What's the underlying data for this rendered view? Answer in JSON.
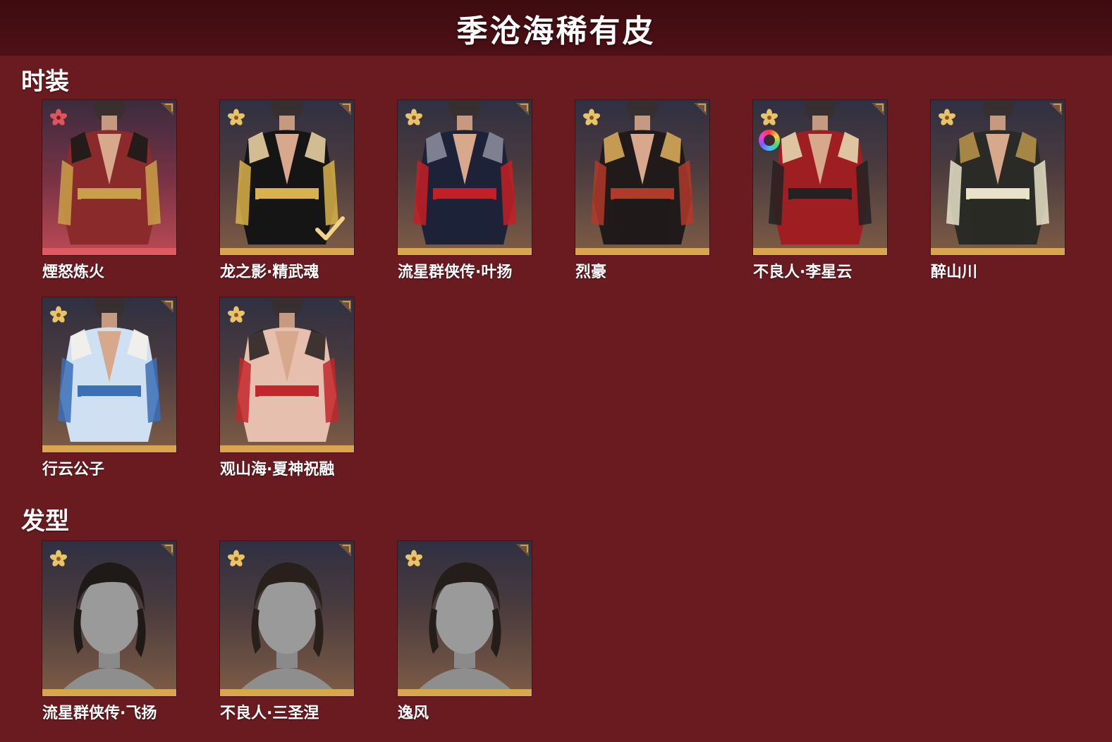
{
  "title": "季沧海稀有皮",
  "sections": [
    {
      "heading": "时装",
      "items": [
        {
          "name": "煙怒炼火",
          "rarity_icon": "red-flower-icon",
          "figure": "outfit",
          "colors": [
            "#8a2a2a",
            "#c9a04a",
            "#1a1a1a"
          ],
          "equipped": false,
          "dye": false
        },
        {
          "name": "龙之影·精武魂",
          "rarity_icon": "gold-flower-icon",
          "figure": "outfit",
          "colors": [
            "#151515",
            "#d8b24a",
            "#e7cfa0"
          ],
          "equipped": true,
          "dye": false
        },
        {
          "name": "流星群侠传·叶扬",
          "rarity_icon": "gold-flower-icon",
          "figure": "outfit",
          "colors": [
            "#1d2238",
            "#c41f25",
            "#8a8a9a"
          ],
          "equipped": false,
          "dye": false
        },
        {
          "name": "烈豪",
          "rarity_icon": "gold-flower-icon",
          "figure": "outfit",
          "colors": [
            "#201a1a",
            "#b23a2a",
            "#d7a85a"
          ],
          "equipped": false,
          "dye": false
        },
        {
          "name": "不良人·李星云",
          "rarity_icon": "gold-flower-icon",
          "figure": "outfit",
          "colors": [
            "#9e1e22",
            "#222222",
            "#e6d6b0"
          ],
          "equipped": false,
          "dye": true
        },
        {
          "name": "醉山川",
          "rarity_icon": "gold-flower-icon",
          "figure": "outfit",
          "colors": [
            "#2a2a26",
            "#e8e2c8",
            "#b39048"
          ],
          "equipped": false,
          "dye": false
        },
        {
          "name": "行云公子",
          "rarity_icon": "gold-flower-icon",
          "figure": "outfit",
          "colors": [
            "#cfe0f2",
            "#3b6fb8",
            "#f4f1ea"
          ],
          "equipped": false,
          "dye": false
        },
        {
          "name": "观山海·夏神祝融",
          "rarity_icon": "gold-flower-icon",
          "figure": "outfit",
          "colors": [
            "#e7bfae",
            "#c2272b",
            "#2a2424"
          ],
          "equipped": false,
          "dye": false
        }
      ]
    },
    {
      "heading": "发型",
      "items": [
        {
          "name": "流星群侠传·飞扬",
          "rarity_icon": "gold-flower-icon",
          "figure": "hair",
          "colors": [
            "#1f1a18",
            "#9a9a9a"
          ],
          "equipped": false,
          "dye": false
        },
        {
          "name": "不良人·三圣涅",
          "rarity_icon": "gold-flower-icon",
          "figure": "hair",
          "colors": [
            "#2a201b",
            "#9a9a9a"
          ],
          "equipped": false,
          "dye": false
        },
        {
          "name": "逸风",
          "rarity_icon": "gold-flower-icon",
          "figure": "hair",
          "colors": [
            "#241d19",
            "#9a9a9a"
          ],
          "equipped": false,
          "dye": false
        }
      ]
    }
  ],
  "theme": {
    "background": "#6a1b20",
    "title_bar": "#3e0c10",
    "gold": "#d9a64d",
    "red_rarity": "#e05a62"
  }
}
